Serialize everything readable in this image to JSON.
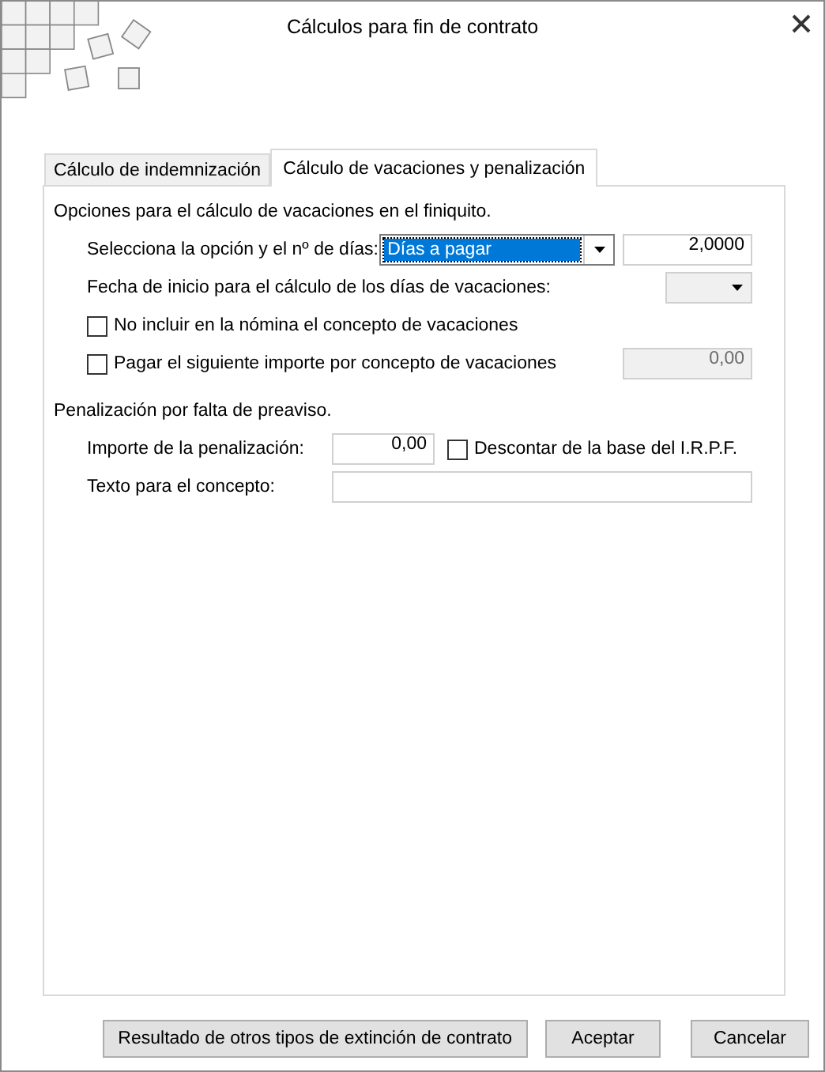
{
  "window": {
    "title": "Cálculos para fin de contrato"
  },
  "tabs": [
    {
      "label": "Cálculo de indemnización",
      "selected": false
    },
    {
      "label": "Cálculo de vacaciones y penalización",
      "selected": true
    }
  ],
  "vacaciones": {
    "heading": "Opciones para el cálculo de vacaciones en el finiquito.",
    "option_label": "Selecciona la opción y el nº de días:",
    "option_select": {
      "value": "Días a pagar",
      "focused": true
    },
    "days_field": {
      "value": "2,0000",
      "disabled": false
    },
    "start_date_label": "Fecha de inicio para el cálculo de los días de vacaciones:",
    "start_date_select": {
      "disabled": true
    },
    "checks": [
      {
        "label": "No incluir en la nómina el concepto de vacaciones",
        "checked": false
      },
      {
        "label": "Pagar el siguiente importe por concepto de vacaciones",
        "checked": false
      }
    ],
    "amount_field": {
      "value": "0,00",
      "disabled": true
    }
  },
  "penalizacion": {
    "heading": "Penalización por falta de preaviso.",
    "amount_label": "Importe de la penalización:",
    "amount_field": {
      "value": "0,00",
      "disabled": false
    },
    "irpf_check": {
      "label": "Descontar de la base del I.R.P.F.",
      "checked": false
    },
    "text_label": "Texto para el concepto:",
    "text_field": {
      "disabled": false
    }
  },
  "buttons": [
    "Resultado de otros tipos de extinción de contrato",
    "Aceptar",
    "Cancelar"
  ]
}
